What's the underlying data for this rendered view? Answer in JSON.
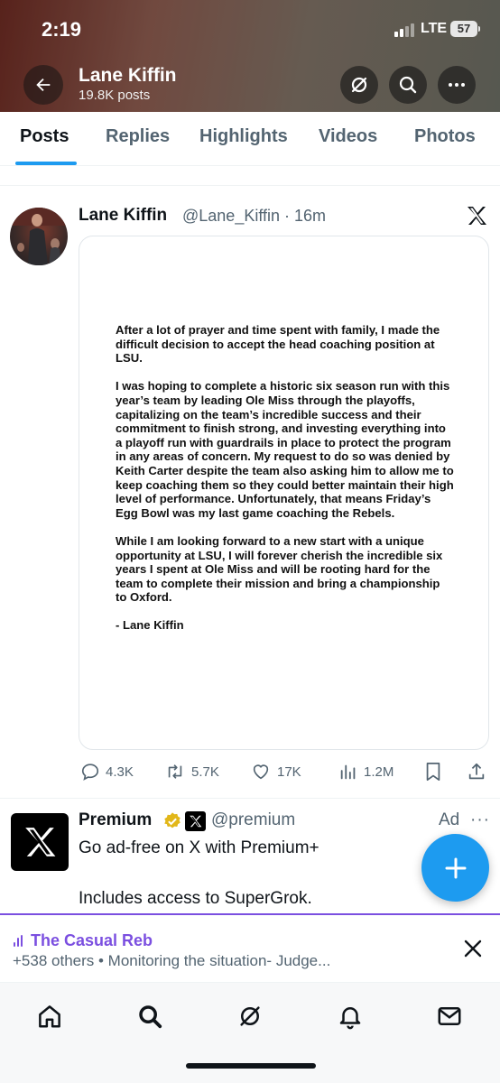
{
  "status_bar": {
    "time": "2:19",
    "network": "LTE",
    "battery": "57"
  },
  "header": {
    "name": "Lane Kiffin",
    "post_count": "19.8K posts",
    "icons": [
      "back-arrow-icon",
      "grok-icon",
      "search-icon",
      "more-icon"
    ]
  },
  "tabs": [
    {
      "label": "Posts",
      "active": true
    },
    {
      "label": "Replies",
      "active": false
    },
    {
      "label": "Highlights",
      "active": false
    },
    {
      "label": "Videos",
      "active": false
    },
    {
      "label": "Photos",
      "active": false
    }
  ],
  "tweet": {
    "author": "Lane Kiffin",
    "handle_time": "@Lane_Kiffin · 16m",
    "statement": {
      "p1": "After a lot of prayer and time spent with family, I made the difficult decision to accept the head coaching position at LSU.",
      "p2": "I was hoping to complete a historic six season run with this year’s team by leading Ole Miss through the playoffs, capitalizing on the team’s incredible success and their commitment to finish strong, and investing everything into a playoff run with guardrails in place to protect the program in any areas of concern. My request to do so was denied by Keith Carter despite the team also asking him to allow me to keep coaching them so they could better maintain their high level of performance. Unfortunately, that means Friday’s Egg Bowl was my last game coaching the Rebels.",
      "p3": "While I am looking forward to a new start with a unique opportunity at LSU, I will forever cherish the incredible six years I spent at Ole Miss and will be rooting hard for the team to complete their mission and bring a championship to Oxford.",
      "signature": "-  Lane Kiffin"
    },
    "actions": {
      "replies": "4.3K",
      "reposts": "5.7K",
      "likes": "17K",
      "views": "1.2M"
    }
  },
  "ad": {
    "name": "Premium",
    "handle": "@premium",
    "label": "Ad",
    "more": "···",
    "text1": "Go ad-free on X with Premium+",
    "text2": "Includes access to SuperGrok."
  },
  "space": {
    "title": "The Casual Reb",
    "subtitle": "+538 others • Monitoring the situation- Judge..."
  },
  "colors": {
    "accent": "#1d9bf0",
    "space_purple": "#7b4fe0",
    "verified_gold": "#e2b719"
  }
}
